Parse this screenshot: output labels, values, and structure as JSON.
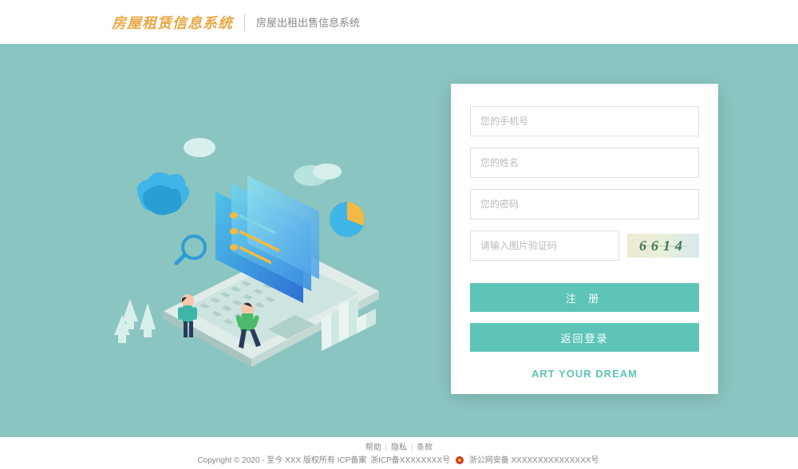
{
  "header": {
    "logo": "房屋租赁信息系统",
    "subtitle": "房屋出租出售信息系统"
  },
  "form": {
    "phone_placeholder": "您的手机号",
    "name_placeholder": "您的姓名",
    "password_placeholder": "您的密码",
    "captcha_placeholder": "请输入图片验证码",
    "captcha_value": "6614",
    "register_label": "注 册",
    "back_login_label": "返回登录",
    "slogan": "ART YOUR DREAM"
  },
  "footer": {
    "link_help": "帮助",
    "link_privacy": "隐私",
    "link_terms": "条款",
    "copyright_prefix": "Copyright © 2020 - 至今 XXX 版权所有  ICP备案 ",
    "icp": "浙ICP备XXXXXXXX号",
    "police": "浙公网安备 XXXXXXXXXXXXXXX号"
  }
}
